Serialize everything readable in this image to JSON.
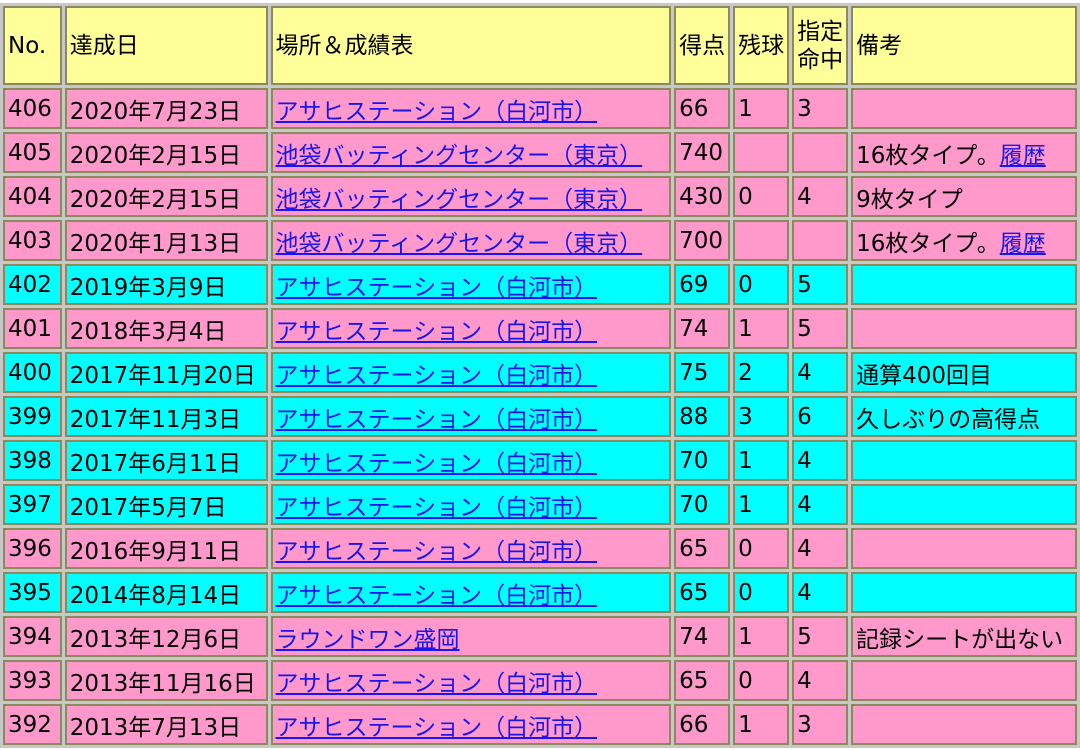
{
  "headers": {
    "no": "No.",
    "date": "達成日",
    "place": "場所＆成績表",
    "score": "得点",
    "remaining": "残球",
    "target_line1": "指定",
    "target_line2": "命中",
    "notes": "備考"
  },
  "rows": [
    {
      "no": "406",
      "date": "2020年7月23日",
      "place": "アサヒステーション（白河市）",
      "score": "66",
      "remaining": "1",
      "target": "3",
      "note": "",
      "note_link": "",
      "color": "pink"
    },
    {
      "no": "405",
      "date": "2020年2月15日",
      "place": "池袋バッティングセンター（東京）",
      "score": "740",
      "remaining": "",
      "target": "",
      "note": "16枚タイプ。",
      "note_link": "履歴",
      "color": "pink"
    },
    {
      "no": "404",
      "date": "2020年2月15日",
      "place": "池袋バッティングセンター（東京）",
      "score": "430",
      "remaining": "0",
      "target": "4",
      "note": "9枚タイプ",
      "note_link": "",
      "color": "pink"
    },
    {
      "no": "403",
      "date": "2020年1月13日",
      "place": "池袋バッティングセンター（東京）",
      "score": "700",
      "remaining": "",
      "target": "",
      "note": "16枚タイプ。",
      "note_link": "履歴",
      "color": "pink"
    },
    {
      "no": "402",
      "date": "2019年3月9日",
      "place": "アサヒステーション（白河市）",
      "score": "69",
      "remaining": "0",
      "target": "5",
      "note": "",
      "note_link": "",
      "color": "cyan"
    },
    {
      "no": "401",
      "date": "2018年3月4日",
      "place": "アサヒステーション（白河市）",
      "score": "74",
      "remaining": "1",
      "target": "5",
      "note": "",
      "note_link": "",
      "color": "pink"
    },
    {
      "no": "400",
      "date": "2017年11月20日",
      "place": "アサヒステーション（白河市）",
      "score": "75",
      "remaining": "2",
      "target": "4",
      "note": "通算400回目",
      "note_link": "",
      "color": "cyan"
    },
    {
      "no": "399",
      "date": "2017年11月3日",
      "place": "アサヒステーション（白河市）",
      "score": "88",
      "remaining": "3",
      "target": "6",
      "note": "久しぶりの高得点",
      "note_link": "",
      "color": "cyan"
    },
    {
      "no": "398",
      "date": "2017年6月11日",
      "place": "アサヒステーション（白河市）",
      "score": "70",
      "remaining": "1",
      "target": "4",
      "note": "",
      "note_link": "",
      "color": "cyan"
    },
    {
      "no": "397",
      "date": "2017年5月7日",
      "place": "アサヒステーション（白河市）",
      "score": "70",
      "remaining": "1",
      "target": "4",
      "note": "",
      "note_link": "",
      "color": "cyan"
    },
    {
      "no": "396",
      "date": "2016年9月11日",
      "place": "アサヒステーション（白河市）",
      "score": "65",
      "remaining": "0",
      "target": "4",
      "note": "",
      "note_link": "",
      "color": "pink"
    },
    {
      "no": "395",
      "date": "2014年8月14日",
      "place": "アサヒステーション（白河市）",
      "score": "65",
      "remaining": "0",
      "target": "4",
      "note": "",
      "note_link": "",
      "color": "cyan"
    },
    {
      "no": "394",
      "date": "2013年12月6日",
      "place": "ラウンドワン盛岡",
      "score": "74",
      "remaining": "1",
      "target": "5",
      "note": "記録シートが出ない",
      "note_link": "",
      "color": "pink"
    },
    {
      "no": "393",
      "date": "2013年11月16日",
      "place": "アサヒステーション（白河市）",
      "score": "65",
      "remaining": "0",
      "target": "4",
      "note": "",
      "note_link": "",
      "color": "pink"
    },
    {
      "no": "392",
      "date": "2013年7月13日",
      "place": "アサヒステーション（白河市）",
      "score": "66",
      "remaining": "1",
      "target": "3",
      "note": "",
      "note_link": "",
      "color": "pink"
    }
  ],
  "colors": {
    "header_bg": "#ffff99",
    "pink_row": "#ff99cc",
    "cyan_row": "#00ffff",
    "link": "#1a14ee"
  }
}
